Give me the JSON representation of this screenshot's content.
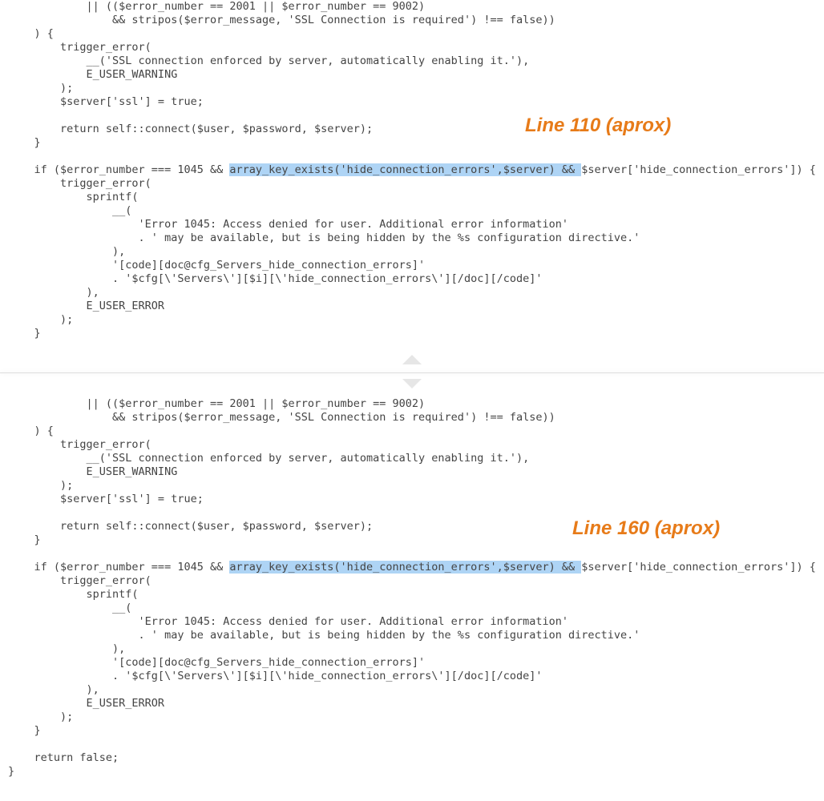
{
  "annotations": {
    "top": "Line 110 (aprox)",
    "bottom": "Line 160 (aprox)"
  },
  "top_block": {
    "pre1": "            || (($error_number == 2001 || $error_number == 9002)\n                && stripos($error_message, 'SSL Connection is required') !== false))\n    ) {\n        trigger_error(\n            __('SSL connection enforced by server, automatically enabling it.'),\n            E_USER_WARNING\n        );\n        $server['ssl'] = true;\n\n        return self::connect($user, $password, $server);\n    }\n\n    if ($error_number === 1045 && ",
    "hl": "array_key_exists('hide_connection_errors',$server) && ",
    "post1": "$server['hide_connection_errors']) {\n        trigger_error(\n            sprintf(\n                __(\n                    'Error 1045: Access denied for user. Additional error information'\n                    . ' may be available, but is being hidden by the %s configuration directive.'\n                ),\n                '[code][doc@cfg_Servers_hide_connection_errors]'\n                . '$cfg[\\'Servers\\'][$i][\\'hide_connection_errors\\'][/doc][/code]'\n            ),\n            E_USER_ERROR\n        );\n    }"
  },
  "bottom_block": {
    "pre1": "            || (($error_number == 2001 || $error_number == 9002)\n                && stripos($error_message, 'SSL Connection is required') !== false))\n    ) {\n        trigger_error(\n            __('SSL connection enforced by server, automatically enabling it.'),\n            E_USER_WARNING\n        );\n        $server['ssl'] = true;\n\n        return self::connect($user, $password, $server);\n    }\n\n    if ($error_number === 1045 && ",
    "hl": "array_key_exists('hide_connection_errors',$server) && ",
    "post1": "$server['hide_connection_errors']) {\n        trigger_error(\n            sprintf(\n                __(\n                    'Error 1045: Access denied for user. Additional error information'\n                    . ' may be available, but is being hidden by the %s configuration directive.'\n                ),\n                '[code][doc@cfg_Servers_hide_connection_errors]'\n                . '$cfg[\\'Servers\\'][$i][\\'hide_connection_errors\\'][/doc][/code]'\n            ),\n            E_USER_ERROR\n        );\n    }\n\n    return false;\n}"
  }
}
